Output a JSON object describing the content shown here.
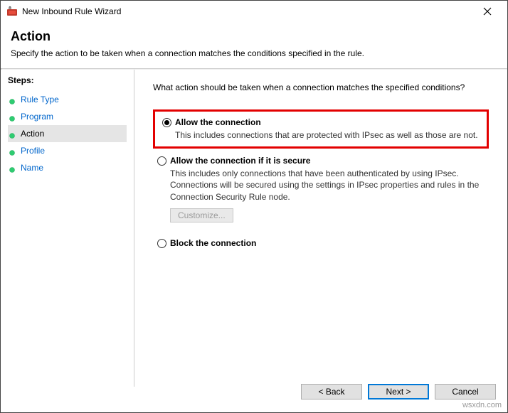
{
  "window": {
    "title": "New Inbound Rule Wizard"
  },
  "header": {
    "title": "Action",
    "subtitle": "Specify the action to be taken when a connection matches the conditions specified in the rule."
  },
  "steps": {
    "label": "Steps:",
    "items": [
      {
        "label": "Rule Type",
        "active": false
      },
      {
        "label": "Program",
        "active": false
      },
      {
        "label": "Action",
        "active": true
      },
      {
        "label": "Profile",
        "active": false
      },
      {
        "label": "Name",
        "active": false
      }
    ]
  },
  "main": {
    "prompt": "What action should be taken when a connection matches the specified conditions?",
    "options": [
      {
        "title": "Allow the connection",
        "desc": "This includes connections that are protected with IPsec as well as those are not.",
        "checked": true,
        "highlight": true
      },
      {
        "title": "Allow the connection if it is secure",
        "desc": "This includes only connections that have been authenticated by using IPsec. Connections will be secured using the settings in IPsec properties and rules in the Connection Security Rule node.",
        "checked": false,
        "highlight": false,
        "customize": "Customize..."
      },
      {
        "title": "Block the connection",
        "desc": "",
        "checked": false,
        "highlight": false
      }
    ]
  },
  "footer": {
    "back": "< Back",
    "next": "Next >",
    "cancel": "Cancel"
  },
  "watermark": "wsxdn.com"
}
